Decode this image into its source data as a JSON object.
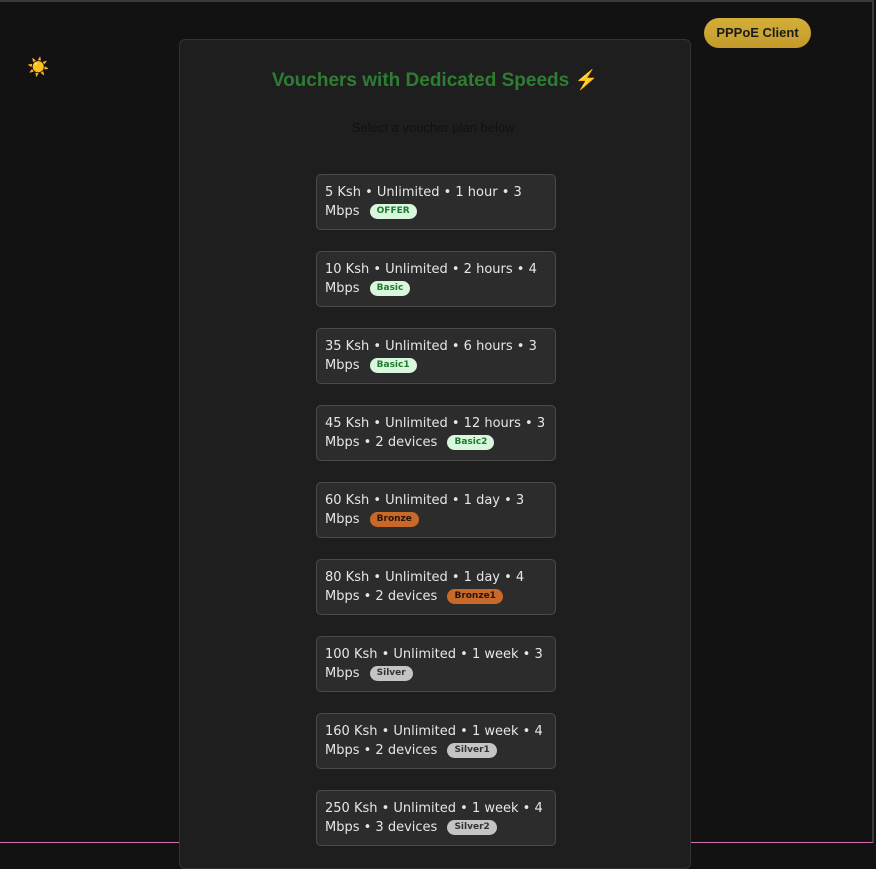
{
  "header": {
    "theme_icon": "sun-icon",
    "pppoe_label": "PPPoE Client"
  },
  "main": {
    "title": "Vouchers with Dedicated Speeds",
    "title_icon": "⚡",
    "subtitle": "Select a voucher plan below:"
  },
  "plans": [
    {
      "text": "5 Ksh • Unlimited • 1 hour • 3 Mbps",
      "badge": "OFFER",
      "badge_bg": "#d9f7dc",
      "badge_fg": "#1e7a2e"
    },
    {
      "text": "10 Ksh • Unlimited • 2 hours • 4 Mbps",
      "badge": "Basic",
      "badge_bg": "#d9f7dc",
      "badge_fg": "#1e7a2e"
    },
    {
      "text": "35 Ksh • Unlimited • 6 hours • 3 Mbps",
      "badge": "Basic1",
      "badge_bg": "#d9f7dc",
      "badge_fg": "#1e7a2e"
    },
    {
      "text": "45 Ksh • Unlimited • 12 hours • 3 Mbps • 2 devices",
      "badge": "Basic2",
      "badge_bg": "#d9f7dc",
      "badge_fg": "#1e7a2e"
    },
    {
      "text": "60 Ksh • Unlimited • 1 day • 3 Mbps",
      "badge": "Bronze",
      "badge_bg": "#c8692a",
      "badge_fg": "#2a1405"
    },
    {
      "text": "80 Ksh • Unlimited • 1 day • 4 Mbps • 2 devices",
      "badge": "Bronze1",
      "badge_bg": "#c8692a",
      "badge_fg": "#2a1405"
    },
    {
      "text": "100 Ksh • Unlimited • 1 week • 3 Mbps",
      "badge": "Silver",
      "badge_bg": "#c4c4c4",
      "badge_fg": "#333333"
    },
    {
      "text": "160 Ksh • Unlimited • 1 week • 4 Mbps • 2 devices",
      "badge": "Silver1",
      "badge_bg": "#c4c4c4",
      "badge_fg": "#333333"
    },
    {
      "text": "250 Ksh • Unlimited • 1 week • 4 Mbps • 3 devices",
      "badge": "Silver2",
      "badge_bg": "#c4c4c4",
      "badge_fg": "#333333"
    }
  ]
}
